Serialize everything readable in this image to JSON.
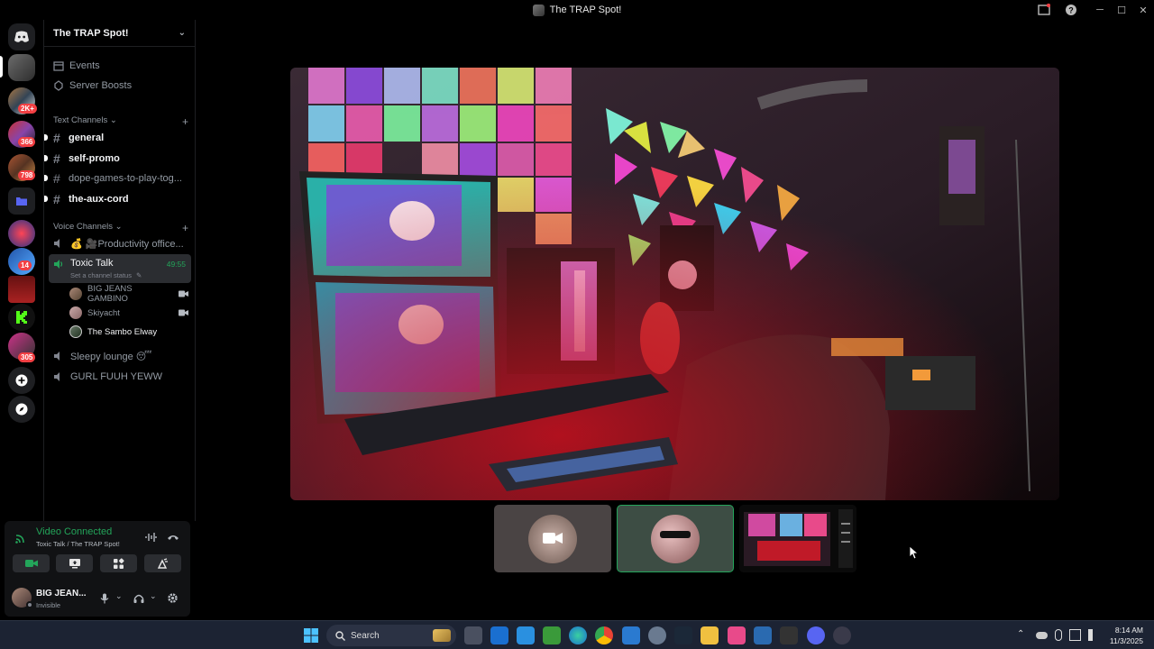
{
  "window": {
    "title": "The TRAP Spot!"
  },
  "rail": {
    "badges": [
      "2K+",
      "366",
      "798",
      "14",
      "305"
    ]
  },
  "sidebar": {
    "server_name": "The TRAP Spot!",
    "nav": [
      {
        "label": "Events",
        "icon": "calendar-icon"
      },
      {
        "label": "Server Boosts",
        "icon": "boost-icon"
      }
    ],
    "text_category": "Text Channels",
    "text_channels": [
      {
        "name": "general",
        "unread": true
      },
      {
        "name": "self-promo",
        "unread": true
      },
      {
        "name": "dope-games-to-play-tog...",
        "unread": true
      },
      {
        "name": "the-aux-cord",
        "unread": true
      }
    ],
    "voice_category": "Voice Channels",
    "voice_channels": [
      {
        "name": "💰 🎥Productivity office..."
      },
      {
        "name": "Toxic Talk",
        "status": "Set a channel status",
        "timer": "49:55",
        "active": true
      },
      {
        "name": "Sleepy lounge 😴"
      },
      {
        "name": "GURL FUUH YEWW"
      }
    ],
    "voice_users": [
      {
        "name": "BIG JEANS GAMBINO",
        "camera": true
      },
      {
        "name": "Skiyacht",
        "camera": true
      },
      {
        "name": "The Sambo Elway",
        "camera": false
      }
    ]
  },
  "panel": {
    "status": "Video Connected",
    "location": "Toxic Talk / The TRAP Spot!",
    "user_name": "BIG JEAN...",
    "user_status": "Invisible"
  },
  "taskbar": {
    "search_placeholder": "Search",
    "time": "8:14 AM",
    "date": "11/3/2025"
  },
  "colors": {
    "accent_green": "#23a55a",
    "badge_red": "#f23f43",
    "background": "#000000"
  }
}
